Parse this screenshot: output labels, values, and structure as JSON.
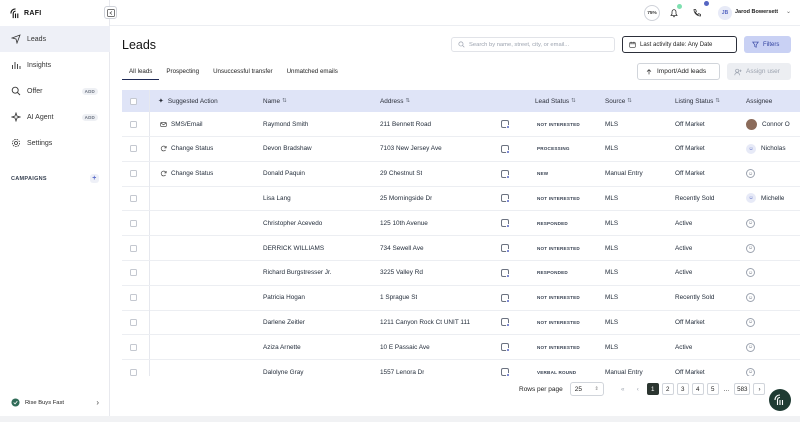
{
  "app": {
    "logo_text": "RAFI"
  },
  "sidebar": {
    "items": [
      {
        "label": "Leads",
        "icon": "leads-icon",
        "active": true
      },
      {
        "label": "Insights",
        "icon": "chart-icon"
      },
      {
        "label": "Offer",
        "icon": "search-icon",
        "badge": "ADD"
      },
      {
        "label": "AI Agent",
        "icon": "sparkle-icon",
        "badge": "ADD"
      },
      {
        "label": "Settings",
        "icon": "gear-icon"
      }
    ],
    "campaigns_label": "CAMPAIGNS",
    "org_name": "Rise Buys Fast"
  },
  "header": {
    "progress_label": "75%",
    "user_initials": "JB",
    "user_name": "Jarod Bowersett"
  },
  "main": {
    "title": "Leads",
    "search_placeholder": "Search by name, street, city, or email...",
    "activity_filter": "Last activity date: Any Date",
    "filters_label": "Filters",
    "tabs": [
      "All leads",
      "Prospecting",
      "Unsuccessful transfer",
      "Unmatched emails"
    ],
    "active_tab": 0,
    "import_label": "Import/Add leads",
    "assign_label": "Assign user"
  },
  "table": {
    "columns": {
      "suggested_action": "Suggested Action",
      "name": "Name",
      "address": "Address",
      "lead_status": "Lead Status",
      "source": "Source",
      "listing_status": "Listing Status",
      "assignee": "Assignee"
    },
    "rows": [
      {
        "action": "SMS/Email",
        "action_icon": "mail-icon",
        "name": "Raymond Smith",
        "address": "211 Bennett Road",
        "status": "NOT INTERESTED",
        "source": "MLS",
        "listing": "Off Market",
        "assignee": "Connor O",
        "assignee_kind": "photo"
      },
      {
        "action": "Change Status",
        "action_icon": "refresh-icon",
        "name": "Devon Bradshaw",
        "address": "7103 New Jersey Ave",
        "status": "PROCESSING",
        "source": "MLS",
        "listing": "Off Market",
        "assignee": "Nicholas",
        "assignee_kind": "person"
      },
      {
        "action": "Change Status",
        "action_icon": "refresh-icon",
        "name": "Donald Paquin",
        "address": "29 Chestnut St",
        "status": "NEW",
        "source": "Manual Entry",
        "listing": "Off Market",
        "assignee": "",
        "assignee_kind": "empty"
      },
      {
        "action": "",
        "name": "Lisa Lang",
        "address": "25 Morningside Dr",
        "status": "NOT INTERESTED",
        "source": "MLS",
        "listing": "Recently Sold",
        "assignee": "Michelle",
        "assignee_kind": "person"
      },
      {
        "action": "",
        "name": "Christopher Acevedo",
        "address": "125 10th Avenue",
        "status": "RESPONDED",
        "source": "MLS",
        "listing": "Active",
        "assignee": "",
        "assignee_kind": "empty"
      },
      {
        "action": "",
        "name": "DERRICK WILLIAMS",
        "address": "734 Sewell Ave",
        "status": "NOT INTERESTED",
        "source": "MLS",
        "listing": "Active",
        "assignee": "",
        "assignee_kind": "empty"
      },
      {
        "action": "",
        "name": "Richard Burgstresser Jr.",
        "address": "3225 Valley Rd",
        "status": "RESPONDED",
        "source": "MLS",
        "listing": "Active",
        "assignee": "",
        "assignee_kind": "empty"
      },
      {
        "action": "",
        "name": "Patricia Hogan",
        "address": "1 Sprague St",
        "status": "NOT INTERESTED",
        "source": "MLS",
        "listing": "Recently Sold",
        "assignee": "",
        "assignee_kind": "empty"
      },
      {
        "action": "",
        "name": "Darlene Zeitler",
        "address": "1211 Canyon Rock Ct UNIT 111",
        "status": "NOT INTERESTED",
        "source": "MLS",
        "listing": "Off Market",
        "assignee": "",
        "assignee_kind": "empty"
      },
      {
        "action": "",
        "name": "Aziza Arnette",
        "address": "10 E Passaic Ave",
        "status": "NOT INTERESTED",
        "source": "MLS",
        "listing": "Active",
        "assignee": "",
        "assignee_kind": "empty"
      },
      {
        "action": "",
        "name": "Dalolyne Gray",
        "address": "1557 Lenora Dr",
        "status": "VERBAL ROUND",
        "source": "Manual Entry",
        "listing": "Off Market",
        "assignee": "",
        "assignee_kind": "empty"
      }
    ]
  },
  "pagination": {
    "rows_per_page_label": "Rows per page",
    "rows_per_page": "25",
    "pages": [
      "1",
      "2",
      "3",
      "4",
      "5"
    ],
    "current_page": "1",
    "ellipsis": "...",
    "last_page": "583"
  }
}
